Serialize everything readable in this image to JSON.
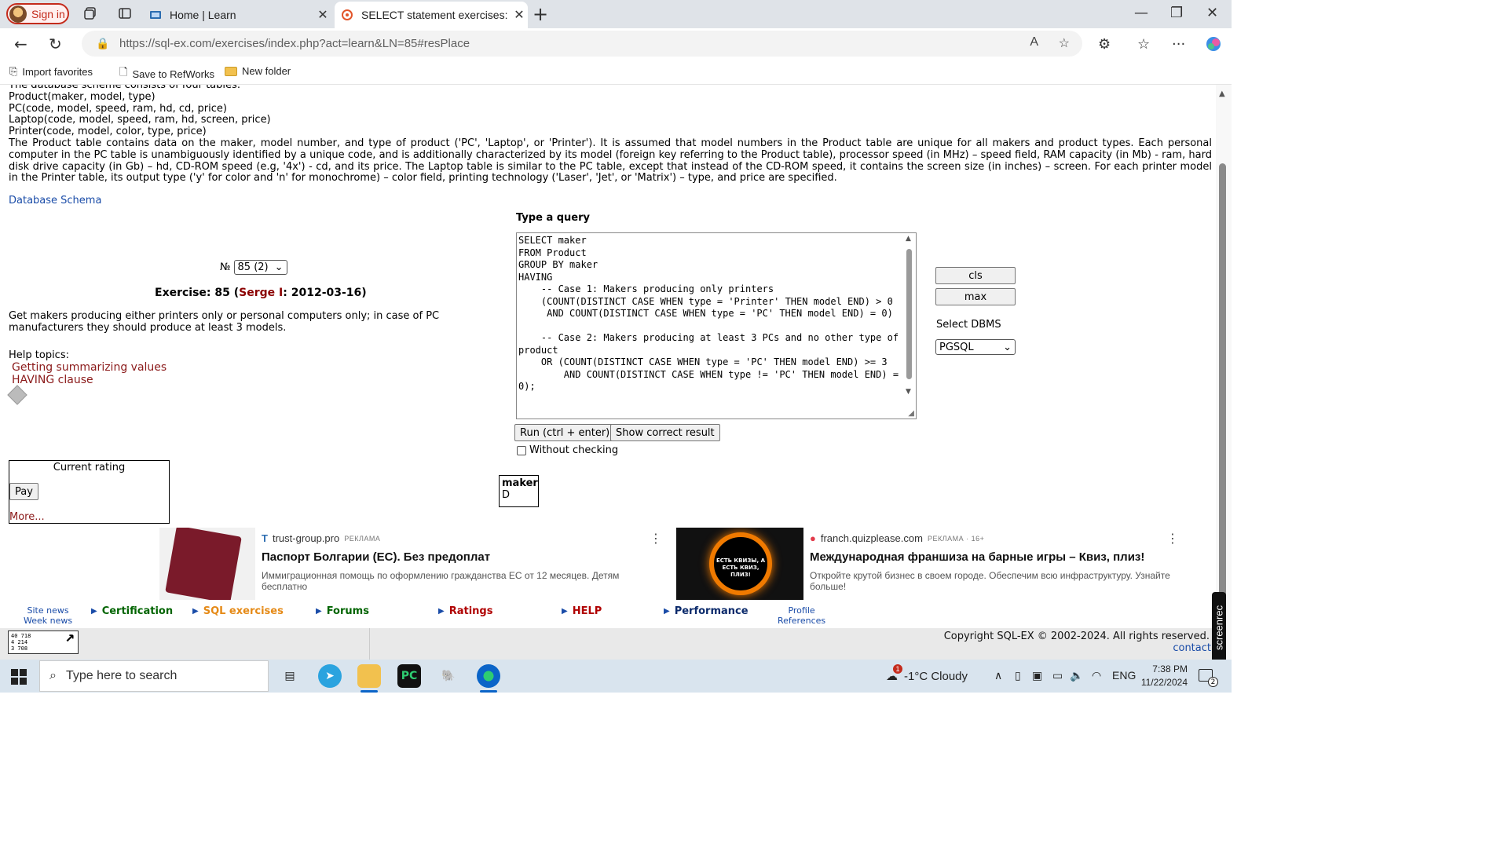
{
  "browser": {
    "signin_label": "Sign in",
    "tabs": [
      {
        "title": "Home | Learn"
      },
      {
        "title": "SELECT statement exercises: learn"
      }
    ],
    "url": "https://sql-ex.com/exercises/index.php?act=learn&LN=85#resPlace",
    "favorites": [
      "Import favorites",
      "Save to RefWorks",
      "New folder"
    ]
  },
  "schema": {
    "lines": [
      "The database scheme consists of four tables:",
      "Product(maker, model, type)",
      "PC(code, model, speed, ram, hd, cd, price)",
      "Laptop(code, model, speed, ram, hd, screen, price)",
      "Printer(code, model, color, type, price)"
    ],
    "description": "The Product table contains data on the maker, model number, and type of product ('PC', 'Laptop', or 'Printer'). It is assumed that model numbers in the Product table are unique for all makers and product types. Each personal computer in the PC table is unambiguously identified by a unique code, and is additionally characterized by its model (foreign key referring to the Product table), processor speed (in MHz) – speed field, RAM capacity (in Mb) - ram, hard disk drive capacity (in Gb) – hd, CD-ROM speed (e.g, '4x') - cd, and its price. The Laptop table is similar to the PC table, except that instead of the CD-ROM speed, it contains the screen size (in inches) – screen. For each printer model in the Printer table, its output type ('y' for color and 'n' for monochrome) – color field, printing technology ('Laser', 'Jet', or 'Matrix') – type, and price are specified.",
    "db_schema_link": "Database Schema"
  },
  "exercise": {
    "number_label": "№",
    "selected": "85 (2)",
    "title_prefix": "Exercise: 85 (",
    "author": "Serge I",
    "title_suffix": ": 2012-03-16)",
    "text": "Get makers producing either printers only or personal computers only; in case of PC manufacturers they should produce at least 3 models.",
    "help_label": "Help topics:",
    "help_topics": [
      "Getting summarizing values",
      "HAVING clause"
    ]
  },
  "rating": {
    "title": "Current rating",
    "pay_label": "Pay",
    "more_label": "More..."
  },
  "query": {
    "label": "Type a query",
    "text": "SELECT maker\nFROM Product\nGROUP BY maker\nHAVING\n    -- Case 1: Makers producing only printers\n    (COUNT(DISTINCT CASE WHEN type = 'Printer' THEN model END) > 0\n     AND COUNT(DISTINCT CASE WHEN type = 'PC' THEN model END) = 0)\n\n    -- Case 2: Makers producing at least 3 PCs and no other type of product\n    OR (COUNT(DISTINCT CASE WHEN type = 'PC' THEN model END) >= 3\n        AND COUNT(DISTINCT CASE WHEN type != 'PC' THEN model END) = 0);",
    "run_label": "Run (ctrl + enter)",
    "show_label": "Show correct result",
    "without_checking": "Without checking"
  },
  "side": {
    "cls_label": "cls",
    "max_label": "max",
    "dbms_label": "Select DBMS",
    "dbms_value": "PGSQL"
  },
  "result": {
    "header": "maker",
    "value": "D"
  },
  "ads": [
    {
      "source": "trust-group.pro",
      "tag": "РЕКЛАМА",
      "headline": "Паспорт Болгарии (ЕС). Без предоплат",
      "body": "Иммиграционная помощь по оформлению гражданства ЕС от 12 месяцев. Детям бесплатно",
      "image_text": ""
    },
    {
      "source": "franch.quizplease.com",
      "tag": "РЕКЛАМА · 16+",
      "headline": "Международная франшиза на барные игры – Квиз, плиз!",
      "body": "Откройте крутой бизнес в своем городе. Обеспечим всю инфраструктуру. Узнайте больше!",
      "image_text": "ЕСТЬ КВИЗЫ, А ЕСТЬ КВИЗ, ПЛИЗ!"
    }
  ],
  "menu": {
    "site_news": "Site news",
    "week_news": "Week news",
    "items": [
      "Certification",
      "SQL exercises",
      "Forums",
      "Ratings",
      "HELP",
      "Performance"
    ],
    "profile": "Profile",
    "references": "References"
  },
  "footer": {
    "counter": [
      "40 718",
      "4 214",
      "3 708"
    ],
    "copyright": "Copyright SQL-EX © 2002-2024. All rights reserved.",
    "contact": "contact"
  },
  "overlay": {
    "screenrec": "screenrec"
  },
  "taskbar": {
    "search_placeholder": "Type here to search",
    "weather": "-1°C  Cloudy",
    "weather_badge": "1",
    "lang": "ENG",
    "time": "7:38 PM",
    "date": "11/22/2024",
    "notifications": "2"
  }
}
